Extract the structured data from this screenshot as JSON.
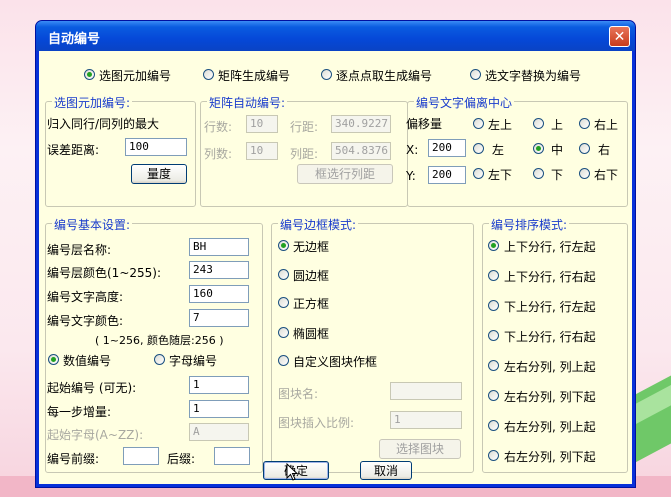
{
  "window": {
    "title": "自动编号",
    "close_symbol": "✕"
  },
  "modes": [
    {
      "label": "选图元加编号",
      "selected": true
    },
    {
      "label": "矩阵生成编号",
      "selected": false
    },
    {
      "label": "逐点点取生成编号",
      "selected": false
    },
    {
      "label": "选文字替换为编号",
      "selected": false
    }
  ],
  "select_group": {
    "legend": "选图元加编号:",
    "desc": "归入同行/同列的最大",
    "tolerance_label": "误差距离:",
    "tolerance_value": "100",
    "measure_button": "量度"
  },
  "matrix_group": {
    "legend": "矩阵自动编号:",
    "rows_label": "行数:",
    "rows_value": "10",
    "row_dist_label": "行距:",
    "row_dist_value": "340.9227",
    "cols_label": "列数:",
    "cols_value": "10",
    "col_dist_label": "列距:",
    "col_dist_value": "504.8376",
    "pick_button": "框选行列距"
  },
  "offset_group": {
    "legend": "编号文字偏离中心",
    "offset_label": "偏移量",
    "x_label": "X:",
    "x_value": "200",
    "y_label": "Y:",
    "y_value": "200",
    "positions": [
      {
        "label": "左上",
        "selected": false
      },
      {
        "label": "上",
        "selected": false
      },
      {
        "label": "右上",
        "selected": false
      },
      {
        "label": "左",
        "selected": false
      },
      {
        "label": "中",
        "selected": true
      },
      {
        "label": "右",
        "selected": false
      },
      {
        "label": "左下",
        "selected": false
      },
      {
        "label": "下",
        "selected": false
      },
      {
        "label": "右下",
        "selected": false
      }
    ]
  },
  "basic_group": {
    "legend": "编号基本设置:",
    "layer_name_label": "编号层名称:",
    "layer_name_value": "BH",
    "layer_color_label": "编号层颜色(1~255):",
    "layer_color_value": "243",
    "text_height_label": "编号文字高度:",
    "text_height_value": "160",
    "text_color_label": "编号文字颜色:",
    "text_color_value": "7",
    "color_hint": "( 1~256, 颜色随层:256 )",
    "numeric_label": "数值编号",
    "numeric_selected": true,
    "alpha_label": "字母编号",
    "alpha_selected": false,
    "start_label": "起始编号 (可无):",
    "start_value": "1",
    "step_label": "每一步增量:",
    "step_value": "1",
    "start_letter_label": "起始字母(A~ZZ):",
    "start_letter_value": "A",
    "prefix_label": "编号前缀:",
    "prefix_value": "",
    "suffix_label": "后缀:",
    "suffix_value": ""
  },
  "border_group": {
    "legend": "编号边框模式:",
    "options": [
      {
        "label": "无边框",
        "selected": true
      },
      {
        "label": "圆边框",
        "selected": false
      },
      {
        "label": "正方框",
        "selected": false
      },
      {
        "label": "椭圆框",
        "selected": false
      },
      {
        "label": "自定义图块作框",
        "selected": false
      }
    ],
    "block_name_label": "图块名:",
    "block_name_value": "",
    "block_scale_label": "图块插入比例:",
    "block_scale_value": "1",
    "select_block_button": "选择图块"
  },
  "order_group": {
    "legend": "编号排序模式:",
    "options": [
      {
        "label": "上下分行, 行左起",
        "selected": true
      },
      {
        "label": "上下分行, 行右起",
        "selected": false
      },
      {
        "label": "下上分行, 行左起",
        "selected": false
      },
      {
        "label": "下上分行, 行右起",
        "selected": false
      },
      {
        "label": "左右分列, 列上起",
        "selected": false
      },
      {
        "label": "左右分列, 列下起",
        "selected": false
      },
      {
        "label": "右左分列, 列上起",
        "selected": false
      },
      {
        "label": "右左分列, 列下起",
        "selected": false
      }
    ]
  },
  "footer": {
    "ok_label": "确定",
    "cancel_label": "取消"
  },
  "colors": {
    "title_bar": "#0a5ce0",
    "client_bg": "#ffffe1",
    "legend_text": "#1a3ccc",
    "radio_dot": "#21a121"
  }
}
